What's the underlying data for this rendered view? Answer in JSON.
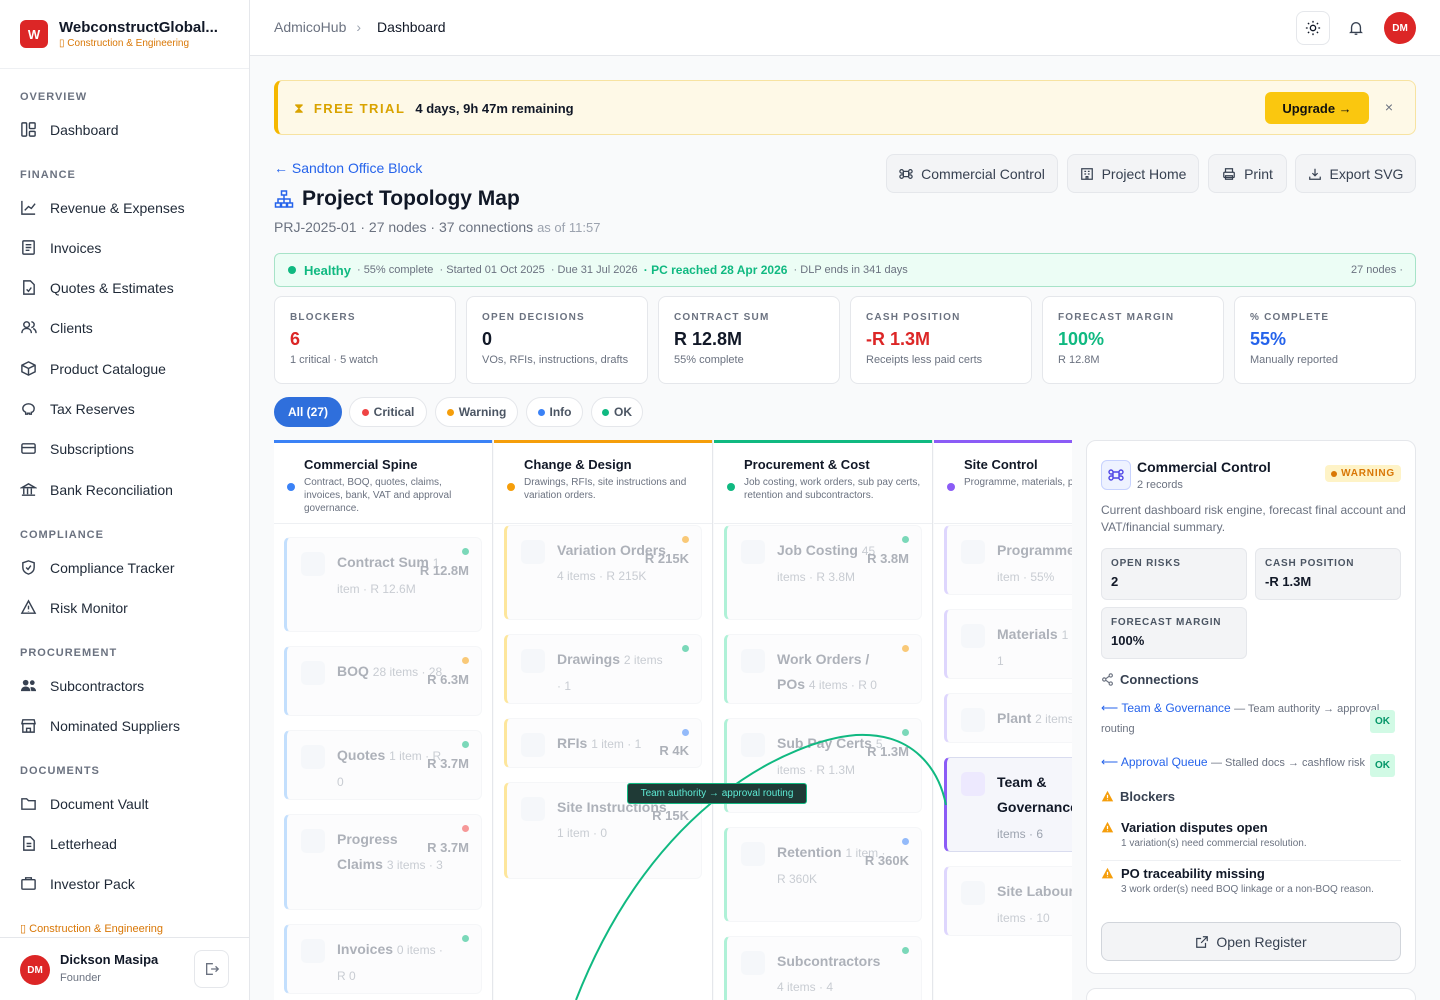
{
  "brand": {
    "logo": "W",
    "name": "WebconstructGlobal...",
    "sub": "Construction & Engineering"
  },
  "nav": {
    "overview": "OVERVIEW",
    "finance": "FINANCE",
    "compliance": "COMPLIANCE",
    "procurement": "PROCUREMENT",
    "documents": "DOCUMENTS",
    "items": [
      {
        "label": "Dashboard",
        "icon": "layout-icon"
      },
      {
        "label": "Revenue & Expenses",
        "icon": "trend-icon"
      },
      {
        "label": "Invoices",
        "icon": "invoice-icon"
      },
      {
        "label": "Quotes & Estimates",
        "icon": "quote-icon"
      },
      {
        "label": "Clients",
        "icon": "users-icon"
      },
      {
        "label": "Product Catalogue",
        "icon": "box-icon"
      },
      {
        "label": "Tax Reserves",
        "icon": "piggy-icon"
      },
      {
        "label": "Subscriptions",
        "icon": "card-icon"
      },
      {
        "label": "Bank Reconciliation",
        "icon": "bank-icon"
      },
      {
        "label": "Compliance Tracker",
        "icon": "shield-icon"
      },
      {
        "label": "Risk Monitor",
        "icon": "alert-icon"
      },
      {
        "label": "Subcontractors",
        "icon": "team-icon"
      },
      {
        "label": "Nominated Suppliers",
        "icon": "store-icon"
      },
      {
        "label": "Document Vault",
        "icon": "folder-icon"
      },
      {
        "label": "Letterhead",
        "icon": "doc-icon"
      },
      {
        "label": "Investor Pack",
        "icon": "briefcase-icon"
      }
    ],
    "footer_tag": "Construction & Engineering"
  },
  "user": {
    "initials": "DM",
    "name": "Dickson Masipa",
    "role": "Founder"
  },
  "topbar": {
    "crumb_root": "AdmicoHub",
    "crumb_current": "Dashboard",
    "avatar": "DM"
  },
  "trial": {
    "label": "FREE TRIAL",
    "remaining": "4 days, 9h 47m remaining",
    "upgrade": "Upgrade →",
    "close": "×"
  },
  "project": {
    "back": "← Sandton Office Block",
    "title": "Project Topology Map",
    "meta": "PRJ-2025-01 · 27 nodes · 37 connections",
    "timestamp": "as of 11:57",
    "actions": [
      "Commercial Control",
      "Project Home",
      "Print",
      "Export SVG"
    ]
  },
  "status": {
    "health": "Healthy",
    "complete": "· 55% complete",
    "started": "· Started 01 Oct 2025",
    "due": "· Due 31 Jul 2026",
    "pc": "· PC reached 28 Apr 2026",
    "dlp": "· DLP ends in 341 days",
    "nodes": "27 nodes ·"
  },
  "kpis": [
    {
      "label": "BLOCKERS",
      "value": "6",
      "sub": "1 critical · 5 watch",
      "color": "#dc2626"
    },
    {
      "label": "OPEN DECISIONS",
      "value": "0",
      "sub": "VOs, RFIs, instructions, drafts",
      "color": "#111827"
    },
    {
      "label": "CONTRACT SUM",
      "value": "R 12.8M",
      "sub": "55% complete",
      "color": "#111827"
    },
    {
      "label": "CASH POSITION",
      "value": "-R 1.3M",
      "sub": "Receipts less paid certs",
      "color": "#dc2626"
    },
    {
      "label": "FORECAST MARGIN",
      "value": "100%",
      "sub": "R 12.8M",
      "color": "#10b981"
    },
    {
      "label": "% COMPLETE",
      "value": "55%",
      "sub": "Manually reported",
      "color": "#2563eb"
    }
  ],
  "filters": [
    {
      "label": "All (27)",
      "color": ""
    },
    {
      "label": "Critical",
      "color": "#ef4444"
    },
    {
      "label": "Warning",
      "color": "#f59e0b"
    },
    {
      "label": "Info",
      "color": "#3b82f6"
    },
    {
      "label": "OK",
      "color": "#10b981"
    }
  ],
  "columns": [
    {
      "title": "Commercial Spine",
      "sub": "Contract, BOQ, quotes, claims, invoices, bank, VAT and approval governance.",
      "color": "#3b82f6",
      "nodes": [
        {
          "title": "Contract Sum",
          "meta": "1 item · R 12.6M",
          "value": "R 12.8M",
          "dot": "#10b981"
        },
        {
          "title": "BOQ",
          "meta": "28 items · 28",
          "value": "R 6.3M",
          "dot": "#f59e0b"
        },
        {
          "title": "Quotes",
          "meta": "1 item · R 0",
          "value": "R 3.7M",
          "dot": "#10b981"
        },
        {
          "title": "Progress Claims",
          "meta": "3 items · 3",
          "value": "R 3.7M",
          "dot": "#ef4444"
        },
        {
          "title": "Invoices",
          "meta": "0 items · R 0",
          "value": "",
          "dot": "#10b981"
        }
      ]
    },
    {
      "title": "Change & Design",
      "sub": "Drawings, RFIs, site instructions and variation orders.",
      "color": "#f59e0b",
      "nodes": [
        {
          "title": "Variation Orders",
          "meta": "4 items · R 215K",
          "value": "R 215K",
          "dot": "#f59e0b"
        },
        {
          "title": "Drawings",
          "meta": "2 items · 1",
          "value": "",
          "dot": "#10b981"
        },
        {
          "title": "RFIs",
          "meta": "1 item · 1",
          "value": "R 4K",
          "dot": "#3b82f6"
        },
        {
          "title": "Site Instructions",
          "meta": "1 item · 0",
          "value": "R 15K",
          "dot": ""
        }
      ]
    },
    {
      "title": "Procurement & Cost",
      "sub": "Job costing, work orders, sub pay certs, retention and subcontractors.",
      "color": "#10b981",
      "nodes": [
        {
          "title": "Job Costing",
          "meta": "45 items · R 3.8M",
          "value": "R 3.8M",
          "dot": "#10b981"
        },
        {
          "title": "Work Orders / POs",
          "meta": "4 items · R 0",
          "value": "",
          "dot": "#f59e0b"
        },
        {
          "title": "Sub Pay Certs",
          "meta": "5 items · R 1.3M",
          "value": "R 1.3M",
          "dot": "#10b981"
        },
        {
          "title": "Retention",
          "meta": "1 item · R 360K",
          "value": "R 360K",
          "dot": "#3b82f6"
        },
        {
          "title": "Subcontractors",
          "meta": "4 items · 4",
          "value": "",
          "dot": "#10b981"
        }
      ]
    },
    {
      "title": "Site Control",
      "sub": "Programme, materials, plant, site labour.",
      "color": "#8b5cf6",
      "nodes": [
        {
          "title": "Programme",
          "meta": "1 item · 55%",
          "value": "",
          "dot": ""
        },
        {
          "title": "Materials",
          "meta": "1 item · 1",
          "value": "",
          "dot": ""
        },
        {
          "title": "Plant",
          "meta": "2 items",
          "value": "",
          "dot": ""
        },
        {
          "title": "Team & Governance",
          "meta": "6 items · 6",
          "value": "",
          "dot": ""
        },
        {
          "title": "Site Labour",
          "meta": "10 items · 10",
          "value": "",
          "dot": ""
        }
      ]
    }
  ],
  "tooltip": "Team authority → approval routing",
  "panel": {
    "title": "Commercial Control",
    "records": "2 records",
    "badge": "WARNING",
    "desc": "Current dashboard risk engine, forecast final account and VAT/financial summary.",
    "minis": [
      {
        "label": "OPEN RISKS",
        "value": "2"
      },
      {
        "label": "CASH POSITION",
        "value": "-R 1.3M"
      },
      {
        "label": "FORECAST MARGIN",
        "value": "100%"
      }
    ],
    "connections_label": "Connections",
    "connections": [
      {
        "link": "Team & Governance",
        "text": "— Team authority → approval routing",
        "status": "OK"
      },
      {
        "link": "Approval Queue",
        "text": "— Stalled docs → cashflow risk",
        "status": "OK"
      }
    ],
    "blockers_label": "Blockers",
    "blockers": [
      {
        "title": "Variation disputes open",
        "sub": "1 variation(s) need commercial resolution."
      },
      {
        "title": "PO traceability missing",
        "sub": "3 work order(s) need BOQ linkage or a non-BOQ reason."
      }
    ],
    "open_register": "Open Register"
  }
}
